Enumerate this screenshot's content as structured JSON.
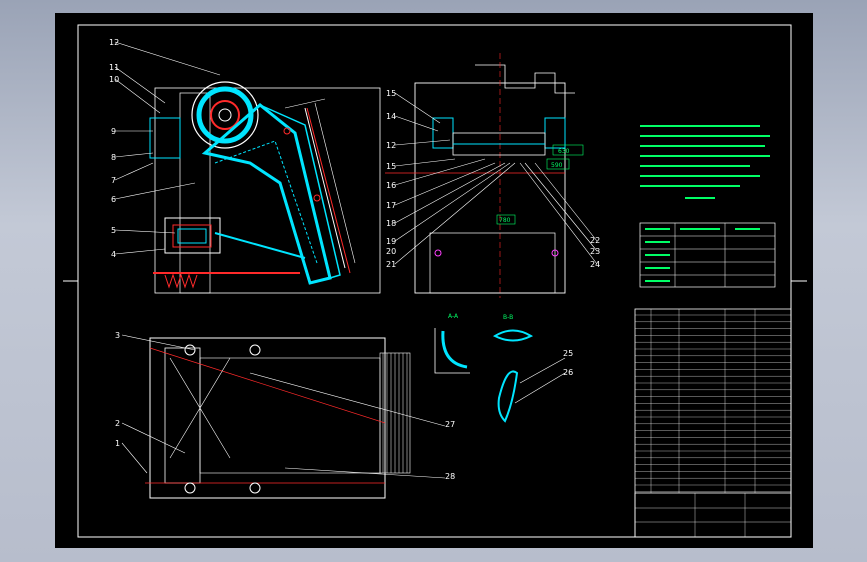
{
  "balloons": {
    "n12a": "12",
    "n11": "11",
    "n10": "10",
    "n9": "9",
    "n8": "8",
    "n7": "7",
    "n6": "6",
    "n5": "5",
    "n4": "4",
    "n15a": "15",
    "n14": "14",
    "n12b": "12",
    "n15b": "15",
    "n16": "16",
    "n17": "17",
    "n18": "18",
    "n19": "19",
    "n20": "20",
    "n21": "21",
    "n22": "22",
    "n23": "23",
    "n24": "24",
    "n3": "3",
    "n2": "2",
    "n1": "1",
    "n27": "27",
    "n28": "28",
    "n25": "25",
    "n26": "26"
  },
  "dimensions": {
    "d1": "630",
    "d2": "590",
    "d3": "780"
  },
  "section_labels": {
    "aa": "A-A",
    "bb": "B-B"
  },
  "colors": {
    "background": "#000000",
    "line": "#ffffff",
    "accent_cyan": "#00e5ff",
    "section_red": "#ff2a2a",
    "notes_green": "#00ff66",
    "magenta": "#ff40ff"
  }
}
